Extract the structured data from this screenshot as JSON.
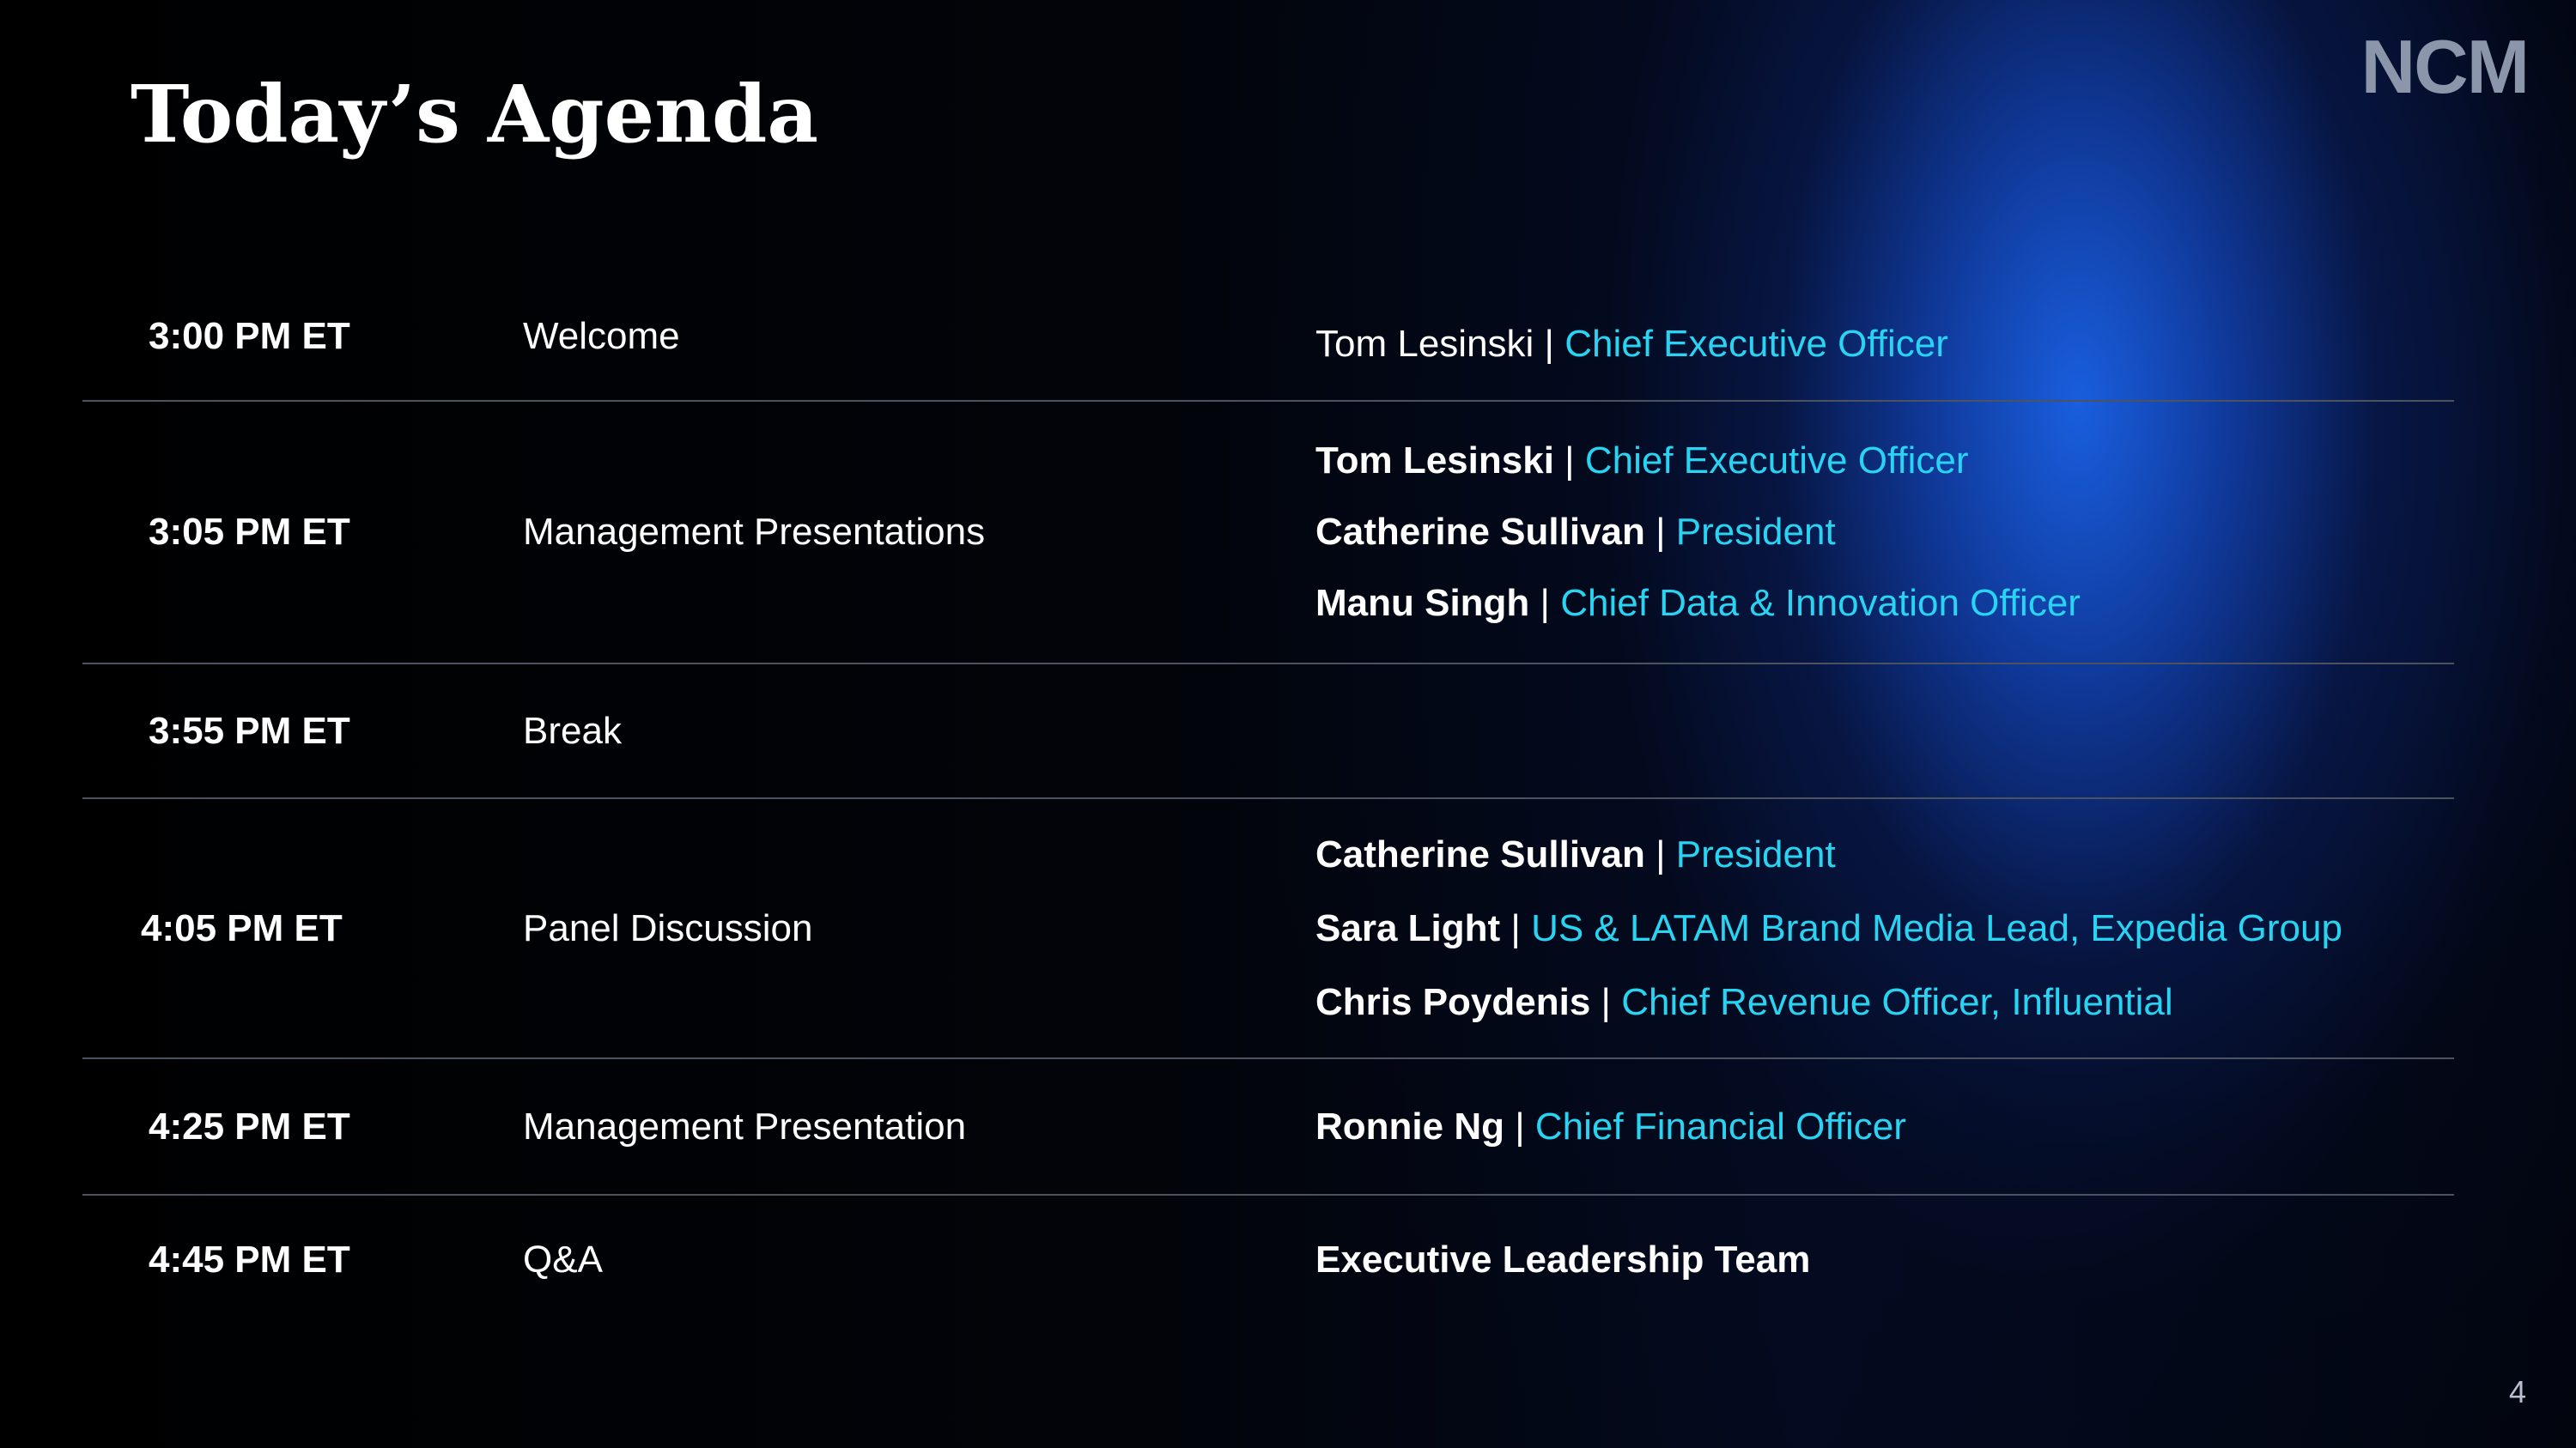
{
  "slide": {
    "title": "Today’s Agenda",
    "logo_text": "NCM",
    "page_number": "4"
  },
  "colors": {
    "background": "#000000",
    "glow": "#1a62e6",
    "role_text": "#29d3f2",
    "divider": "#4d5260"
  },
  "agenda": [
    {
      "time": "3:00 PM ET",
      "session": "Welcome",
      "speakers": [
        {
          "name": "Tom Lesinski",
          "separator": "|",
          "role": "Chief Executive Officer"
        }
      ]
    },
    {
      "time": "3:05 PM ET",
      "session": "Management Presentations",
      "speakers": [
        {
          "name": "Tom Lesinski",
          "separator": "|",
          "role": "Chief Executive Officer"
        },
        {
          "name": "Catherine Sullivan",
          "separator": "|",
          "role": "President"
        },
        {
          "name": "Manu Singh",
          "separator": "|",
          "role": "Chief Data & Innovation Officer"
        }
      ]
    },
    {
      "time": "3:55 PM ET",
      "session": "Break",
      "speakers": []
    },
    {
      "time": "4:05 PM ET",
      "session": "Panel Discussion",
      "speakers": [
        {
          "name": "Catherine Sullivan",
          "separator": "|",
          "role": "President"
        },
        {
          "name": "Sara Light",
          "separator": "|",
          "role": "US & LATAM Brand Media Lead, Expedia Group"
        },
        {
          "name": "Chris Poydenis",
          "separator": "|",
          "role": "Chief Revenue Officer, Influential"
        }
      ]
    },
    {
      "time": "4:25 PM ET",
      "session": "Management Presentation",
      "speakers": [
        {
          "name": "Ronnie Ng",
          "separator": "|",
          "role": "Chief Financial Officer"
        }
      ]
    },
    {
      "time": "4:45 PM ET",
      "session": "Q&A",
      "speakers": [
        {
          "name": "Executive Leadership Team"
        }
      ]
    }
  ]
}
